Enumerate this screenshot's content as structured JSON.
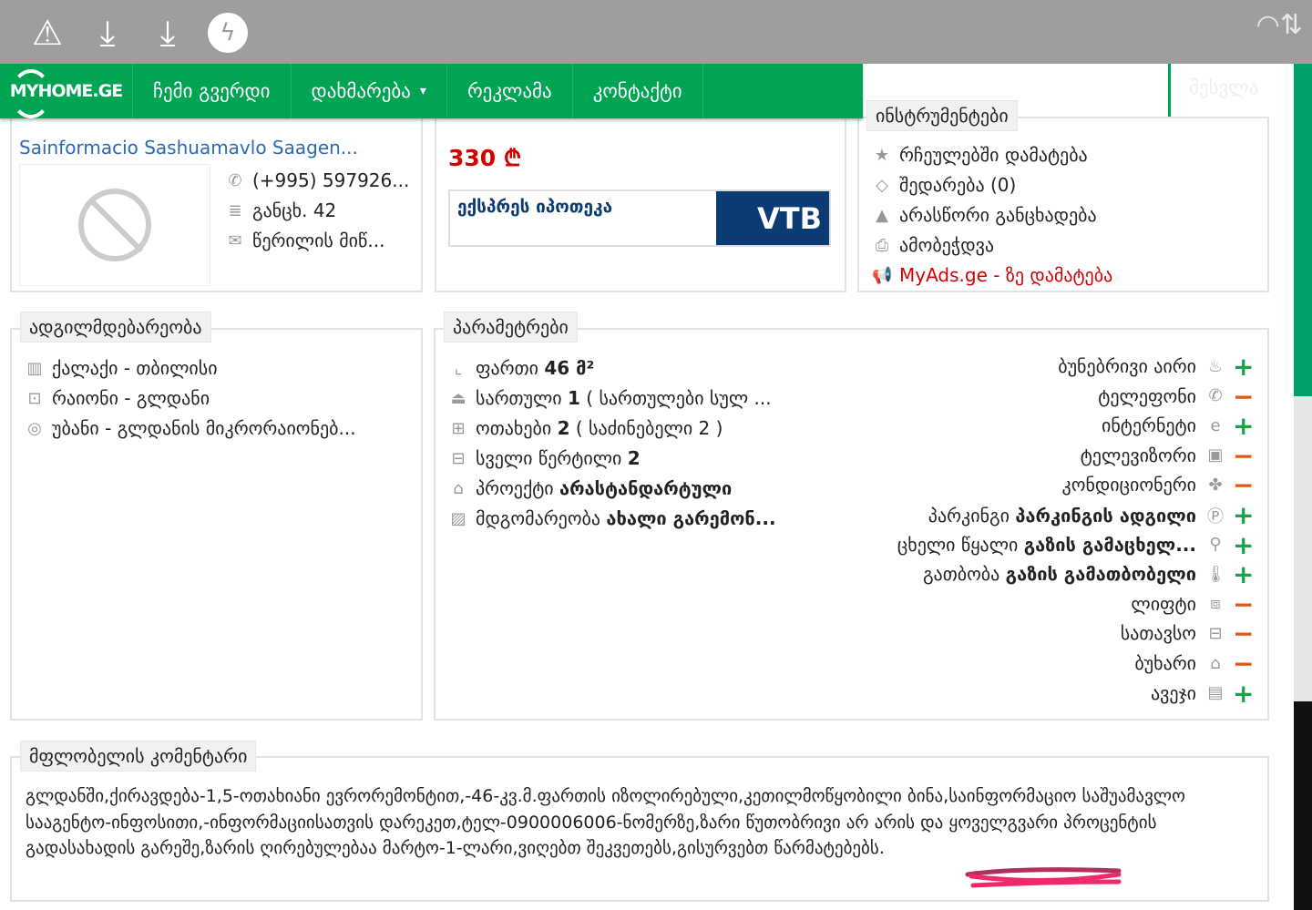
{
  "status_bar": {
    "icons": [
      "warning-icon",
      "download-icon",
      "download-icon",
      "messenger-icon",
      "wifi-icon"
    ]
  },
  "nav": {
    "logo": "MYHOME.GE",
    "items": [
      "ჩემი გვერდი",
      "დახმარება",
      "რეკლამა",
      "კონტაქტი"
    ],
    "dropdown_arrow": "▾",
    "login": "შესვლა"
  },
  "agent": {
    "name": "Sainformacio Sashuamavlo Saagen...",
    "phone": "(+995) 597926...",
    "ads": "განცხ. 42",
    "message": "წერილის მიწ..."
  },
  "price": {
    "value": "330 ₾",
    "mortgage": "ექსპრეს იპოთეკა",
    "bank": "VTB"
  },
  "tools": {
    "title": "ინსტრუმენტები",
    "items": [
      "რჩეულებში დამატება",
      "შედარება (0)",
      "არასწორი განცხადება",
      "ამობეჭდვა",
      "MyAds.ge - ზე დამატება"
    ]
  },
  "location": {
    "title": "ადგილმდებარეობა",
    "items": [
      "ქალაქი - თბილისი",
      "რაიონი - გლდანი",
      "უბანი - გლდანის მიკრორაიონებ..."
    ]
  },
  "params": {
    "title": "პარამეტრები",
    "left": [
      {
        "label": "ფართი",
        "value": "46 მ²",
        "extra": ""
      },
      {
        "label": "სართული",
        "value": "1",
        "extra": "( სართულები სულ ..."
      },
      {
        "label": "ოთახები",
        "value": "2",
        "extra": "( საძინებელი 2 )"
      },
      {
        "label": "სველი წერტილი",
        "value": "2",
        "extra": ""
      },
      {
        "label": "პროექტი",
        "value": "არასტანდარტული",
        "extra": ""
      },
      {
        "label": "მდგომარეობა",
        "value": "ახალი გარემონ...",
        "extra": ""
      }
    ],
    "right": [
      {
        "label": "ბუნებრივი აირი",
        "value": "",
        "icon": "gas-icon",
        "has": true
      },
      {
        "label": "ტელეფონი",
        "value": "",
        "icon": "phone-icon",
        "has": false
      },
      {
        "label": "ინტერნეტი",
        "value": "",
        "icon": "internet-icon",
        "has": true
      },
      {
        "label": "ტელევიზორი",
        "value": "",
        "icon": "tv-icon",
        "has": false
      },
      {
        "label": "კონდიციონერი",
        "value": "",
        "icon": "fan-icon",
        "has": false
      },
      {
        "label": "პარკინგი",
        "value": "პარკინგის ადგილი",
        "icon": "parking-icon",
        "has": true
      },
      {
        "label": "ცხელი წყალი",
        "value": "გაზის გამაცხელ...",
        "icon": "tap-icon",
        "has": true
      },
      {
        "label": "გათბობა",
        "value": "გაზის გამათბობელი",
        "icon": "thermometer-icon",
        "has": true
      },
      {
        "label": "ლიფტი",
        "value": "",
        "icon": "elevator-icon",
        "has": false
      },
      {
        "label": "სათავსო",
        "value": "",
        "icon": "storage-icon",
        "has": false
      },
      {
        "label": "ბუხარი",
        "value": "",
        "icon": "fireplace-icon",
        "has": false
      },
      {
        "label": "ავეჯი",
        "value": "",
        "icon": "furniture-icon",
        "has": true
      }
    ]
  },
  "comment": {
    "title": "მფლობელის კომენტარი",
    "text": "გლდანში,ქირავდება-1,5-ოთახიანი ევრორემონტით,-46-კვ.მ.ფართის იზოლირებული,კეთილმოწყობილი ბინა,საინფორმაციო საშუამავლო სააგენტო-ინფოსითი,-ინფორმაციისათვის დარეკეთ,ტელ-0900006006-ნომერზე,ზარი წუთობრივი არ არის და ყოველგვარი პროცენტის გადასახადის გარეშე,ზარის ღირებულებაა მარტო-1-ლარი,ვიღებთ შეკვეთებს,გისურვებთ წარმატებებს."
  },
  "colors": {
    "green": "#00a453",
    "price_red": "#d40000",
    "link_blue": "#2a6ab0",
    "vtb": "#0b3a74",
    "plus": "#1aa34a",
    "minus": "#e2541a"
  }
}
